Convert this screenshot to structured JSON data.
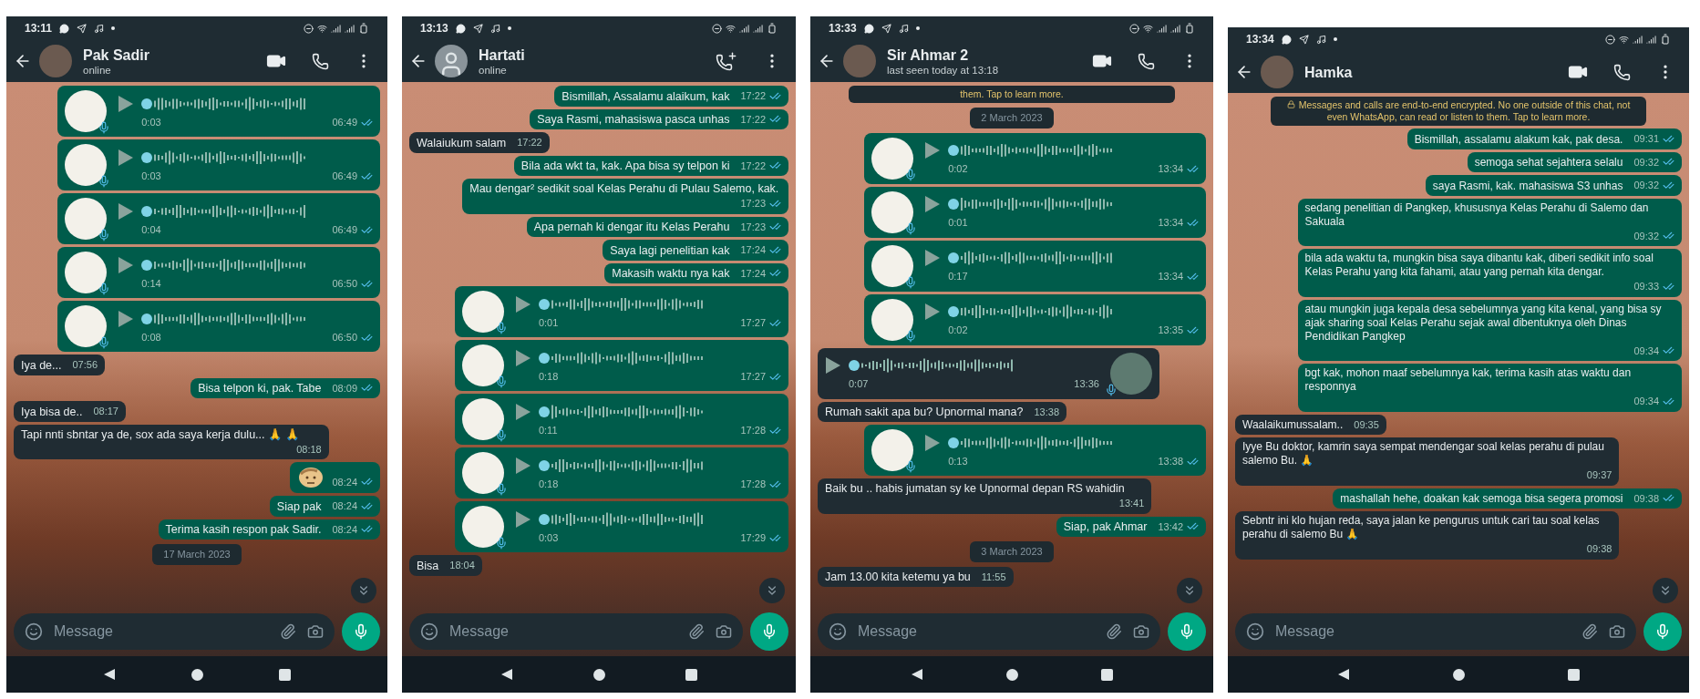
{
  "phones": [
    {
      "status_time": "13:11",
      "contact": {
        "name": "Pak Sadir",
        "subtitle": "online",
        "avatar": {
          "kind": "photo"
        }
      },
      "header_actions": [
        {
          "kind": "video"
        },
        {
          "kind": "call"
        },
        {
          "kind": "menu"
        }
      ],
      "messages": [
        {
          "kind": "voice",
          "outgoing": true,
          "duration": "0:03",
          "time": "06:49",
          "read": true
        },
        {
          "kind": "voice",
          "outgoing": true,
          "duration": "0:03",
          "time": "06:49",
          "read": true
        },
        {
          "kind": "voice",
          "outgoing": true,
          "duration": "0:04",
          "time": "06:49",
          "read": true
        },
        {
          "kind": "voice",
          "outgoing": true,
          "duration": "0:14",
          "time": "06:50",
          "read": true
        },
        {
          "kind": "voice",
          "outgoing": true,
          "duration": "0:08",
          "time": "06:50",
          "read": true
        },
        {
          "kind": "text",
          "outgoing": false,
          "text": "Iya de...",
          "time": "07:56"
        },
        {
          "kind": "text",
          "outgoing": true,
          "text": "Bisa telpon ki, pak. Tabe",
          "time": "08:09",
          "read": true
        },
        {
          "kind": "text",
          "outgoing": false,
          "text": "Iya bisa de..",
          "time": "08:17"
        },
        {
          "kind": "text",
          "outgoing": false,
          "text": "Tapi nnti sbntar ya de, sox ada saya kerja dulu... 🙏 🙏",
          "time": "08:18"
        },
        {
          "kind": "sticker",
          "outgoing": true,
          "time": "08:24",
          "read": true
        },
        {
          "kind": "text",
          "outgoing": true,
          "text": "Siap pak",
          "time": "08:24",
          "read": true
        },
        {
          "kind": "text",
          "outgoing": true,
          "text": "Terima kasih respon pak Sadir.",
          "time": "08:24",
          "read": true
        },
        {
          "kind": "date",
          "text": "17 March 2023"
        }
      ],
      "composer": {
        "placeholder": "Message"
      }
    },
    {
      "status_time": "13:13",
      "contact": {
        "name": "Hartati",
        "subtitle": "online",
        "avatar": {
          "kind": "silhouette"
        }
      },
      "header_actions": [
        {
          "kind": "add-call"
        },
        {
          "kind": "menu"
        }
      ],
      "messages": [
        {
          "kind": "text",
          "outgoing": true,
          "text": "Bismillah, Assalamu alaikum, kak",
          "time": "17:22",
          "read": true
        },
        {
          "kind": "text",
          "outgoing": true,
          "text": "Saya Rasmi, mahasiswa pasca unhas",
          "time": "17:22",
          "read": true
        },
        {
          "kind": "text",
          "outgoing": false,
          "text": "Walaiukum salam",
          "time": "17:22"
        },
        {
          "kind": "text",
          "outgoing": true,
          "text": "Bila ada wkt ta, kak. Apa bisa sy telpon ki",
          "time": "17:22",
          "read": true
        },
        {
          "kind": "text",
          "outgoing": true,
          "text": "Mau dengar² sedikit soal Kelas Perahu di Pulau Salemo, kak.",
          "time": "17:23",
          "read": true
        },
        {
          "kind": "text",
          "outgoing": true,
          "text": "Apa pernah ki dengar itu Kelas Perahu",
          "time": "17:23",
          "read": true
        },
        {
          "kind": "text",
          "outgoing": true,
          "text": "Saya lagi penelitian kak",
          "time": "17:24",
          "read": true
        },
        {
          "kind": "text",
          "outgoing": true,
          "text": "Makasih waktu nya kak",
          "time": "17:24",
          "read": true
        },
        {
          "kind": "voice",
          "outgoing": true,
          "duration": "0:01",
          "time": "17:27",
          "read": true
        },
        {
          "kind": "voice",
          "outgoing": true,
          "duration": "0:18",
          "time": "17:27",
          "read": true
        },
        {
          "kind": "voice",
          "outgoing": true,
          "duration": "0:11",
          "time": "17:28",
          "read": true
        },
        {
          "kind": "voice",
          "outgoing": true,
          "duration": "0:18",
          "time": "17:28",
          "read": true
        },
        {
          "kind": "voice",
          "outgoing": true,
          "duration": "0:03",
          "time": "17:29",
          "read": true
        },
        {
          "kind": "text",
          "outgoing": false,
          "text": "Bisa",
          "time": "18:04"
        }
      ],
      "composer": {
        "placeholder": "Message"
      }
    },
    {
      "status_time": "13:33",
      "contact": {
        "name": "Sir Ahmar 2",
        "subtitle": "last seen today at 13:18",
        "avatar": {
          "kind": "photo"
        }
      },
      "header_actions": [
        {
          "kind": "video"
        },
        {
          "kind": "call"
        },
        {
          "kind": "menu"
        }
      ],
      "messages": [
        {
          "kind": "notice",
          "text": "them. Tap to learn more."
        },
        {
          "kind": "date",
          "text": "2 March 2023"
        },
        {
          "kind": "voice",
          "outgoing": true,
          "duration": "0:02",
          "time": "13:34",
          "read": true
        },
        {
          "kind": "voice",
          "outgoing": true,
          "duration": "0:01",
          "time": "13:34",
          "read": true
        },
        {
          "kind": "voice",
          "outgoing": true,
          "duration": "0:17",
          "time": "13:34",
          "read": true
        },
        {
          "kind": "voice",
          "outgoing": true,
          "duration": "0:02",
          "time": "13:35",
          "read": true
        },
        {
          "kind": "voice",
          "outgoing": false,
          "duration": "0:07",
          "time": "13:36"
        },
        {
          "kind": "text",
          "outgoing": false,
          "text": "Rumah sakit apa bu? Upnormal mana?",
          "time": "13:38"
        },
        {
          "kind": "voice",
          "outgoing": true,
          "duration": "0:13",
          "time": "13:38",
          "read": true
        },
        {
          "kind": "text",
          "outgoing": false,
          "text": "Baik bu .. habis jumatan sy ke Upnormal depan RS wahidin",
          "time": "13:41"
        },
        {
          "kind": "text",
          "outgoing": true,
          "text": "Siap, pak Ahmar",
          "time": "13:42",
          "read": true
        },
        {
          "kind": "date",
          "text": "3 March 2023"
        },
        {
          "kind": "text",
          "outgoing": false,
          "text": "Jam 13.00 kita ketemu ya bu",
          "time": "11:55"
        }
      ],
      "composer": {
        "placeholder": "Message"
      }
    },
    {
      "status_time": "13:34",
      "contact": {
        "name": "Hamka",
        "avatar": {
          "kind": "photo"
        }
      },
      "header_actions": [
        {
          "kind": "video"
        },
        {
          "kind": "call"
        },
        {
          "kind": "menu"
        }
      ],
      "messages": [
        {
          "kind": "notice",
          "text": "Messages and calls are end-to-end encrypted. No one outside of this chat, not even WhatsApp, can read or listen to them. Tap to learn more.",
          "locked": true
        },
        {
          "kind": "text",
          "outgoing": true,
          "text": "Bismillah, assalamu alakum kak, pak desa.",
          "time": "09:31",
          "read": true
        },
        {
          "kind": "text",
          "outgoing": true,
          "text": "semoga sehat sejahtera selalu",
          "time": "09:32",
          "read": true
        },
        {
          "kind": "text",
          "outgoing": true,
          "text": "saya Rasmi, kak. mahasiswa S3 unhas",
          "time": "09:32",
          "read": true
        },
        {
          "kind": "text",
          "outgoing": true,
          "text": "sedang penelitian di Pangkep, khususnya Kelas Perahu di Salemo dan Sakuala",
          "time": "09:32",
          "read": true
        },
        {
          "kind": "text",
          "outgoing": true,
          "text": "bila ada waktu ta, mungkin bisa saya dibantu kak, diberi sedikit info soal Kelas Perahu yang kita fahami, atau yang pernah kita dengar.",
          "time": "09:33",
          "read": true
        },
        {
          "kind": "text",
          "outgoing": true,
          "text": "atau mungkin juga kepala desa sebelumnya yang kita kenal, yang bisa sy ajak sharing soal Kelas Perahu sejak awal dibentuknya oleh Dinas Pendidikan Pangkep",
          "time": "09:34",
          "read": true
        },
        {
          "kind": "text",
          "outgoing": true,
          "text": "bgt kak, mohon maaf sebelumnya kak, terima kasih atas waktu dan responnya",
          "time": "09:34",
          "read": true
        },
        {
          "kind": "text",
          "outgoing": false,
          "text": "Waalaikumussalam..",
          "time": "09:35"
        },
        {
          "kind": "text",
          "outgoing": false,
          "text": "Iyye Bu doktor, kamrin saya sempat mendengar soal kelas perahu di pulau salemo Bu. 🙏",
          "time": "09:37"
        },
        {
          "kind": "text",
          "outgoing": true,
          "text": "mashallah hehe, doakan kak semoga bisa segera promosi",
          "time": "09:38",
          "read": true
        },
        {
          "kind": "text",
          "outgoing": false,
          "text": "Sebntr ini klo hujan reda, saya jalan ke pengurus untuk cari tau soal kelas perahu di salemo Bu 🙏",
          "time": "09:38"
        }
      ],
      "composer": {
        "placeholder": "Message"
      }
    }
  ]
}
